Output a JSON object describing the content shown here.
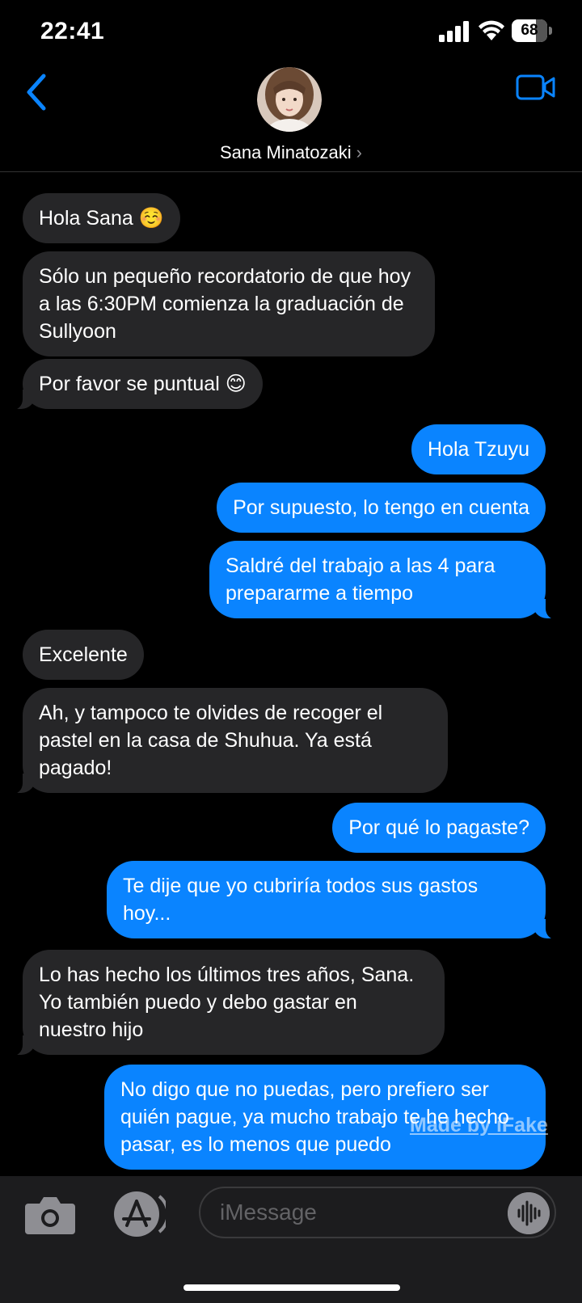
{
  "status_bar": {
    "time": "22:41",
    "battery": "68",
    "battery_level": 0.68
  },
  "header": {
    "contact_name": "Sana Minatozaki",
    "chevron": "›",
    "back_icon": "chevron-left-icon",
    "video_icon": "video-camera-icon"
  },
  "messages": [
    {
      "from": "them",
      "text": "Hola Sana ☺️"
    },
    {
      "from": "them",
      "text": "Sólo un pequeño recordatorio de que hoy a las 6:30PM comienza la graduación de Sullyoon"
    },
    {
      "from": "them",
      "text": "Por favor se puntual 😊"
    },
    {
      "from": "me",
      "text": "Hola Tzuyu"
    },
    {
      "from": "me",
      "text": "Por supuesto, lo tengo en cuenta"
    },
    {
      "from": "me",
      "text": "Saldré del trabajo a las 4 para prepararme a tiempo"
    },
    {
      "from": "them",
      "text": "Excelente"
    },
    {
      "from": "them",
      "text": "Ah, y tampoco te olvides de recoger el pastel en la casa de Shuhua. Ya está pagado!"
    },
    {
      "from": "me",
      "text": "Por qué lo pagaste?"
    },
    {
      "from": "me",
      "text": "Te dije que yo cubriría todos sus gastos hoy..."
    },
    {
      "from": "them",
      "text": "Lo has hecho los últimos tres años, Sana. Yo también puedo y debo gastar en nuestro hijo"
    },
    {
      "from": "me",
      "text": "No digo que no puedas, pero prefiero ser quién pague, ya mucho trabajo te he hecho pasar, es lo menos que puedo"
    }
  ],
  "watermark": "Made by iFake",
  "input": {
    "placeholder": "iMessage",
    "camera_icon": "camera-icon",
    "apps_icon": "app-store-icon",
    "audio_icon": "waveform-icon"
  },
  "colors": {
    "sent": "#0a84ff",
    "received": "#262628",
    "background": "#000000"
  }
}
